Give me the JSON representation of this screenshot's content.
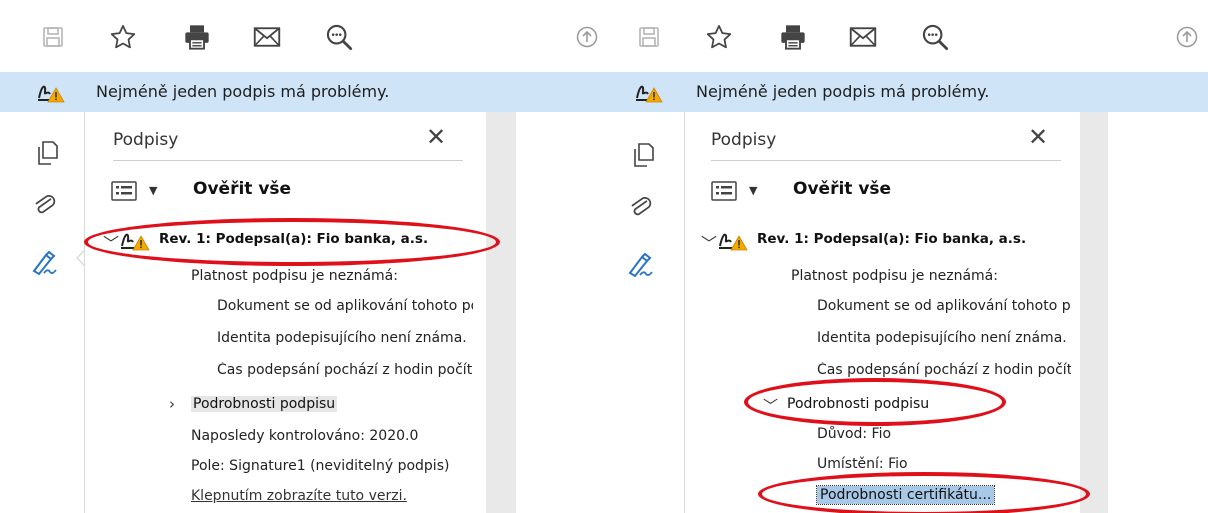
{
  "colors": {
    "banner_bg": "#cfe4f6",
    "accent_blue": "#2a74c4",
    "warning": "#f4a800",
    "annotation_red": "#e0101b",
    "selection": "#a8c8e8"
  },
  "toolbar": {
    "icons": [
      "save-icon",
      "star-icon",
      "print-icon",
      "mail-icon",
      "search-zoom-icon",
      "upload-icon"
    ]
  },
  "banner": {
    "text": "Nejméně jeden podpis má problémy."
  },
  "left_rail": {
    "icons": [
      "pages-icon",
      "attachment-icon",
      "signature-pen-icon"
    ]
  },
  "signature_panel": {
    "title": "Podpisy",
    "close_symbol": "✕",
    "verify_all": "Ověřit vše",
    "revision": "Rev. 1: Podepsal(a): Fio banka, a.s.",
    "validity": "Platnost podpisu je neznámá:",
    "validity_details": [
      "Dokument se od aplikování tohoto podpisu nezměnil.",
      "Identita podepisujícího není známa.",
      "Čas podepsání pochází z hodin počítače podepisujícího."
    ],
    "signature_details": "Podrobnosti podpisu"
  },
  "left_pane": {
    "last_checked": "Naposledy kontrolováno: 2020.0",
    "field": "Pole: Signature1 (neviditelný podpis)",
    "view_version_link": "Klepnutím zobrazíte tuto verzi."
  },
  "right_pane": {
    "reason": "Důvod: Fio",
    "location": "Umístění: Fio",
    "certificate_details": "Podrobnosti certifikátu..."
  }
}
